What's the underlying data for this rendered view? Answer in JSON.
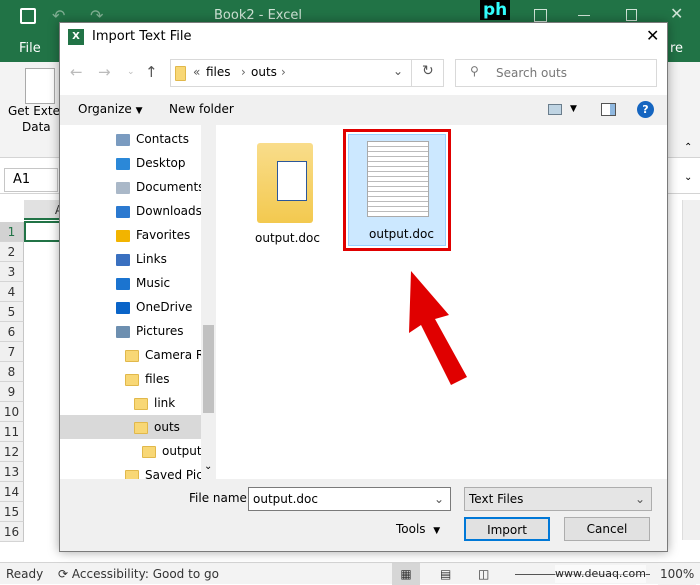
{
  "excel": {
    "title": "Book2 - Excel",
    "file_tab": "File",
    "share_tab_partial": "re",
    "get_external_data": "Get Extern",
    "get_external_data_line2": "Data",
    "name_box": "A1",
    "column_a": "A",
    "rows": [
      "1",
      "2",
      "3",
      "4",
      "5",
      "6",
      "7",
      "8",
      "9",
      "10",
      "11",
      "12",
      "13",
      "14",
      "15",
      "16"
    ],
    "status_ready": "Ready",
    "accessibility": "Accessibility: Good to go",
    "zoom": "100%",
    "logo_text": "ph",
    "accent": "#217346"
  },
  "dialog": {
    "title": "Import Text File",
    "breadcrumb": [
      "«",
      "files",
      "outs"
    ],
    "search_placeholder": "Search outs",
    "toolbar": {
      "organize": "Organize",
      "new_folder": "New folder"
    },
    "nav_items": [
      {
        "label": "Contacts",
        "icon": "contacts-icon"
      },
      {
        "label": "Desktop",
        "icon": "desktop-icon"
      },
      {
        "label": "Documents",
        "icon": "documents-icon"
      },
      {
        "label": "Downloads",
        "icon": "downloads-icon"
      },
      {
        "label": "Favorites",
        "icon": "star-icon"
      },
      {
        "label": "Links",
        "icon": "links-icon"
      },
      {
        "label": "Music",
        "icon": "music-icon"
      },
      {
        "label": "OneDrive",
        "icon": "cloud-icon"
      },
      {
        "label": "Pictures",
        "icon": "pictures-icon"
      },
      {
        "label": "Camera Ro",
        "icon": "folder-icon"
      },
      {
        "label": "files",
        "icon": "folder-icon"
      },
      {
        "label": "link",
        "icon": "folder-icon"
      },
      {
        "label": "outs",
        "icon": "folder-icon",
        "selected": true
      },
      {
        "label": "output.",
        "icon": "folder-icon"
      },
      {
        "label": "Saved Pict",
        "icon": "folder-icon"
      }
    ],
    "files": [
      {
        "name": "output.doc",
        "type": "folder"
      },
      {
        "name": "output.doc",
        "type": "document",
        "selected": true
      }
    ],
    "file_name_label": "File name:",
    "file_name_value": "output.doc",
    "file_type": "Text Files",
    "tools": "Tools",
    "import": "Import",
    "cancel": "Cancel",
    "highlight_color": "#e00000"
  },
  "watermark": "www.deuaq.com"
}
